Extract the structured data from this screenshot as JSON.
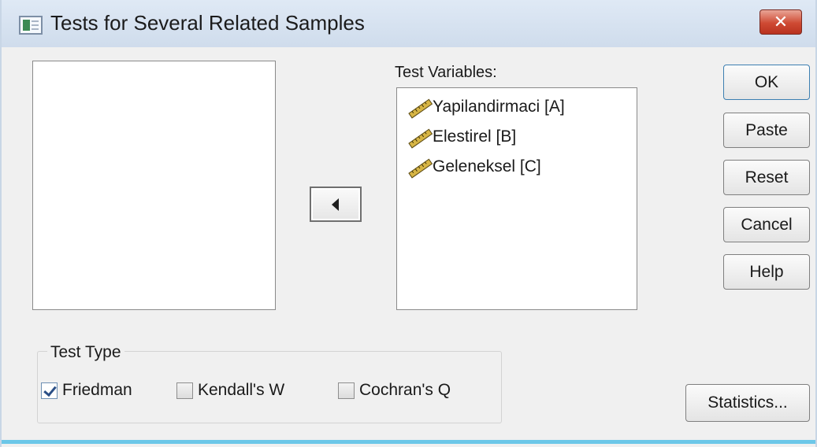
{
  "window": {
    "title": "Tests for Several Related Samples",
    "close_glyph": "✕",
    "app_icon": "dialog-window-icon"
  },
  "source_list": {
    "items": []
  },
  "move_button": {
    "icon": "left-arrow-icon"
  },
  "test_variables": {
    "label": "Test Variables:",
    "items": [
      {
        "label": "Yapilandirmaci [A]",
        "icon": "scale-variable-ruler-icon"
      },
      {
        "label": "Elestirel [B]",
        "icon": "scale-variable-ruler-icon"
      },
      {
        "label": "Geleneksel [C]",
        "icon": "scale-variable-ruler-icon"
      }
    ]
  },
  "buttons": {
    "ok": "OK",
    "paste": "Paste",
    "reset": "Reset",
    "cancel": "Cancel",
    "help": "Help",
    "statistics": "Statistics..."
  },
  "test_type": {
    "title": "Test Type",
    "options": [
      {
        "label": "Friedman",
        "checked": true
      },
      {
        "label": "Kendall's W",
        "checked": false
      },
      {
        "label": "Cochran's Q",
        "checked": false
      }
    ]
  },
  "colors": {
    "window_background": "#f0f0f0",
    "close_button": "#cf4a33",
    "bottom_accent": "#6cc7e8",
    "default_button_border": "#3c7fb1"
  }
}
